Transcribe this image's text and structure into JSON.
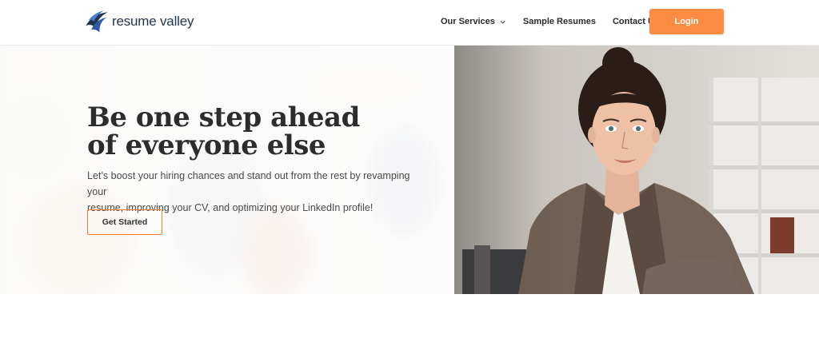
{
  "brand": {
    "name": "resume valley"
  },
  "nav": {
    "items": [
      {
        "label": "Our Services",
        "has_dropdown": true
      },
      {
        "label": "Sample Resumes"
      },
      {
        "label": "Contact Us"
      }
    ],
    "login_label": "Login"
  },
  "hero": {
    "title_line1": "Be one step ahead",
    "title_line2": "of everyone else",
    "subtitle_line1": "Let’s boost your hiring chances and stand out from the rest by revamping your",
    "subtitle_line2": "resume, improving your CV, and optimizing your LinkedIn profile!",
    "cta_label": "Get Started"
  },
  "colors": {
    "accent": "#fb8c42",
    "cta_border": "#f07d33",
    "brand_navy": "#1f3550"
  },
  "icons": {
    "logo": "resume-valley-swoosh-logo",
    "dropdown": "chevron-down-icon"
  }
}
